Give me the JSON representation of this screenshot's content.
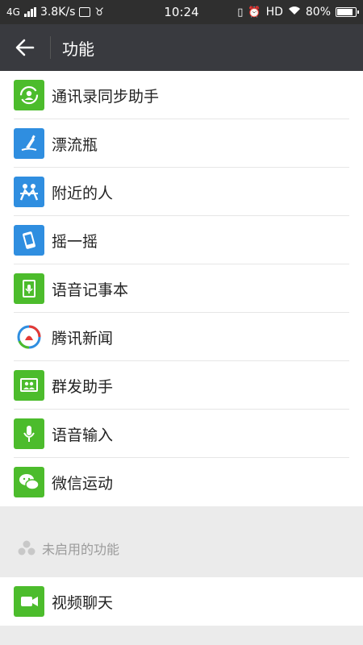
{
  "statusbar": {
    "network": "4G",
    "speed": "3.8K/s",
    "time": "10:24",
    "hd": "HD",
    "battery": "80%",
    "battery_level": 0.8
  },
  "header": {
    "title": "功能"
  },
  "enabled_features": [
    {
      "label": "通讯录同步助手",
      "icon": "contact-sync-icon",
      "color": "#4cbc2c"
    },
    {
      "label": "漂流瓶",
      "icon": "drift-bottle-icon",
      "color": "#2f8ee0"
    },
    {
      "label": "附近的人",
      "icon": "people-nearby-icon",
      "color": "#2f8ee0"
    },
    {
      "label": "摇一摇",
      "icon": "shake-icon",
      "color": "#2f8ee0"
    },
    {
      "label": "语音记事本",
      "icon": "voice-notepad-icon",
      "color": "#4cbc2c"
    },
    {
      "label": "腾讯新闻",
      "icon": "tencent-news-icon",
      "color": "#ffffff"
    },
    {
      "label": "群发助手",
      "icon": "mass-send-icon",
      "color": "#4cbc2c"
    },
    {
      "label": "语音输入",
      "icon": "voice-input-icon",
      "color": "#4cbc2c"
    },
    {
      "label": "微信运动",
      "icon": "wechat-sports-icon",
      "color": "#4cbc2c"
    }
  ],
  "disabled_section": {
    "title": "未启用的功能"
  },
  "disabled_features": [
    {
      "label": "视频聊天",
      "icon": "video-chat-icon",
      "color": "#4cbc2c"
    }
  ]
}
